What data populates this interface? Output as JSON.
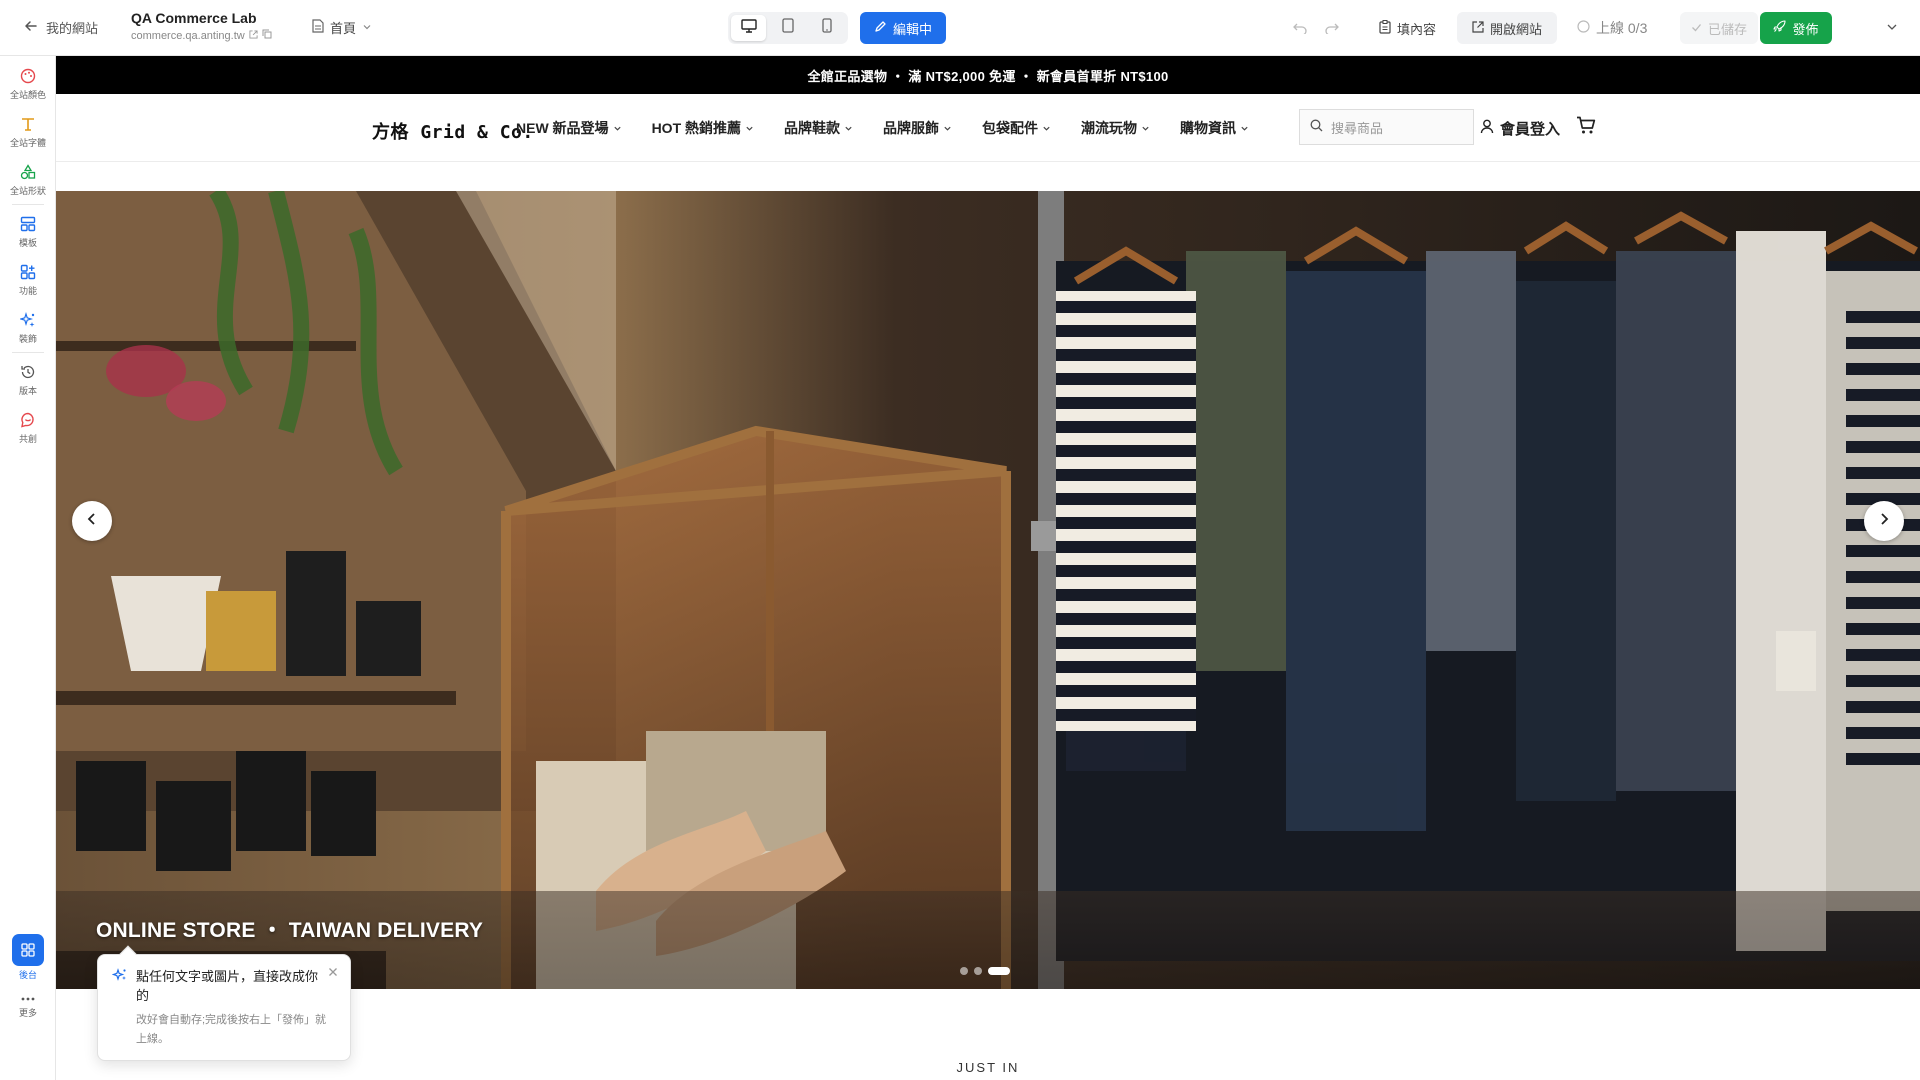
{
  "editor": {
    "back_label": "我的網站",
    "site_name": "QA Commerce Lab",
    "site_domain": "commerce.qa.anting.tw",
    "page_select": "首頁",
    "edit_mode_label": "編輯中",
    "fill_content_label": "填內容",
    "open_site_label": "開啟網站",
    "online_status": "上線 0/3",
    "saved_label": "已儲存",
    "publish_label": "發佈"
  },
  "rail": {
    "items": [
      {
        "label": "全站顏色",
        "icon": "palette-icon"
      },
      {
        "label": "全站字體",
        "icon": "typography-icon"
      },
      {
        "label": "全站形狀",
        "icon": "shapes-icon"
      },
      {
        "label": "模板",
        "icon": "template-icon"
      },
      {
        "label": "功能",
        "icon": "widgets-icon"
      },
      {
        "label": "裝飾",
        "icon": "sparkle-icon"
      },
      {
        "label": "版本",
        "icon": "history-icon"
      },
      {
        "label": "共創",
        "icon": "chat-icon"
      }
    ],
    "backend_label": "後台",
    "more_label": "更多"
  },
  "store": {
    "announcement": "全館正品選物 ・ 滿 NT$2,000 免運 ・ 新會員首單折 NT$100",
    "logo": "方格 Grid & Co.",
    "nav": [
      "NEW 新品登場",
      "HOT 熱銷推薦",
      "品牌鞋款",
      "品牌服飾",
      "包袋配件",
      "潮流玩物",
      "購物資訊"
    ],
    "search_placeholder": "搜尋商品",
    "login_label": "會員登入",
    "hero_caption": "ONLINE STORE ・ TAIWAN DELIVERY",
    "carousel": {
      "slides": 3,
      "active": 3
    },
    "section_title": "JUST IN"
  },
  "tooltip": {
    "title": "點任何文字或圖片，直接改成你的",
    "body": "改好會自動存;完成後按右上「發佈」就上線。"
  },
  "colors": {
    "accent": "#1f6feb",
    "publish": "#16a34a",
    "announcement_bg": "#000000"
  }
}
